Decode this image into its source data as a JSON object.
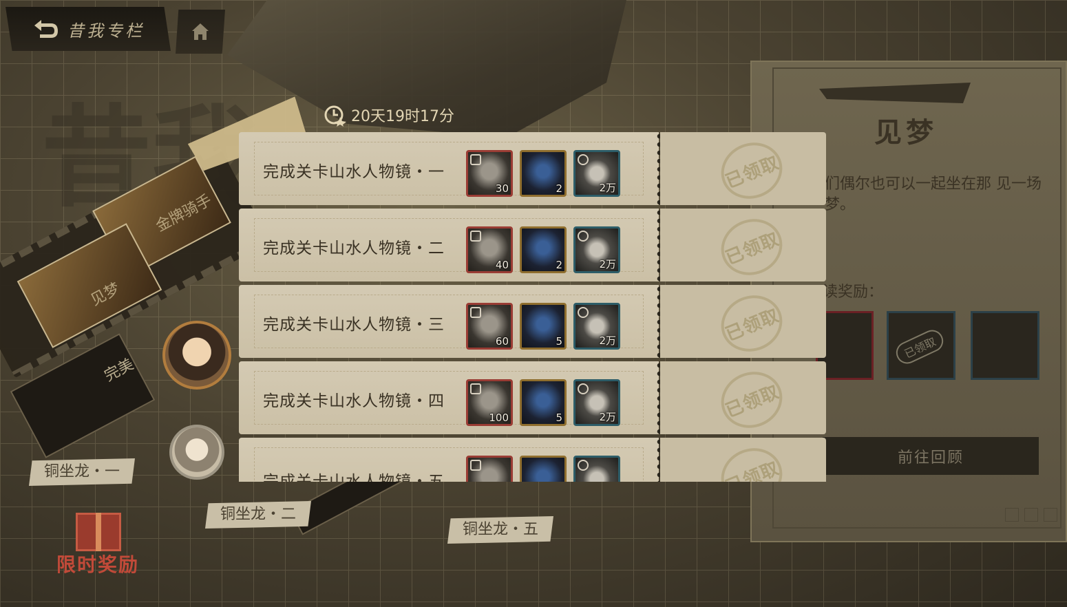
{
  "topbar": {
    "back_title": "昔我专栏"
  },
  "timer": {
    "remaining": "20天19时17分"
  },
  "tasks": [
    {
      "name": "完成关卡山水人物镜・一",
      "items": [
        "30",
        "2",
        "2万"
      ],
      "status": "已领取"
    },
    {
      "name": "完成关卡山水人物镜・二",
      "items": [
        "40",
        "2",
        "2万"
      ],
      "status": "已领取"
    },
    {
      "name": "完成关卡山水人物镜・三",
      "items": [
        "60",
        "5",
        "2万"
      ],
      "status": "已领取"
    },
    {
      "name": "完成关卡山水人物镜・四",
      "items": [
        "100",
        "5",
        "2万"
      ],
      "status": "已领取"
    },
    {
      "name": "完成关卡山水人物镜・五",
      "items": [
        "",
        "",
        ""
      ],
      "status": "已领取"
    }
  ],
  "side_panel": {
    "title": "见梦",
    "description": "们偶尔也可以一起坐在那 见一场梦。",
    "reward_label": "读奖励：",
    "stamp": "已领取",
    "goto_button": "前往回顾"
  },
  "stages": {
    "node_1": "铜坐龙・一",
    "node_2": "铜坐龙・二",
    "node_5": "铜坐龙・五",
    "film_1": "金牌骑手",
    "film_2": "见梦",
    "complete": "完美"
  },
  "limited_reward": {
    "label": "限时奖励"
  },
  "colors": {
    "accent": "#cdb98a",
    "red_frame": "#9a3c34",
    "gold_frame": "#8f6e2e",
    "teal_frame": "#2d5d68"
  }
}
